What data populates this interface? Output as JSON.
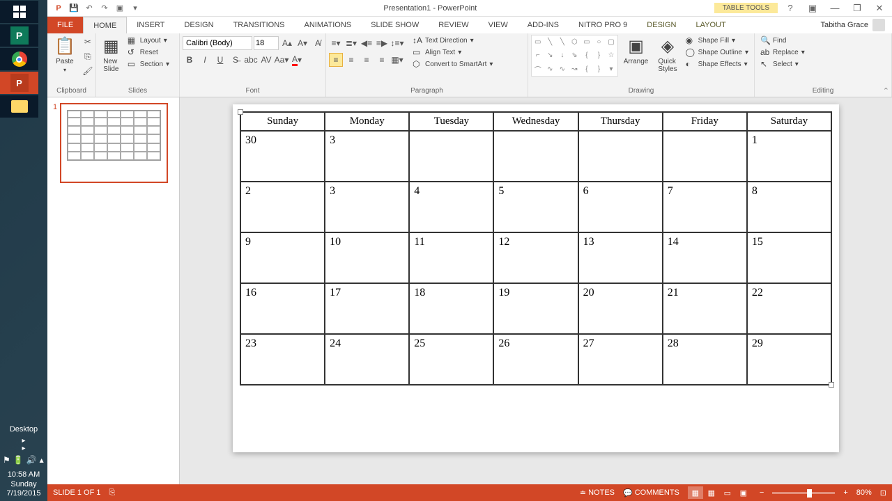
{
  "title": "Presentation1 - PowerPoint",
  "contextual_tab_group": "TABLE TOOLS",
  "user_name": "Tabitha Grace",
  "tabs": {
    "file": "FILE",
    "home": "HOME",
    "insert": "INSERT",
    "design": "DESIGN",
    "transitions": "TRANSITIONS",
    "animations": "ANIMATIONS",
    "slideshow": "SLIDE SHOW",
    "review": "REVIEW",
    "view": "VIEW",
    "addins": "ADD-INS",
    "nitro": "NITRO PRO 9",
    "ctx_design": "DESIGN",
    "ctx_layout": "LAYOUT"
  },
  "ribbon": {
    "clipboard": {
      "label": "Clipboard",
      "paste": "Paste"
    },
    "slides": {
      "label": "Slides",
      "new_slide": "New\nSlide",
      "layout": "Layout",
      "reset": "Reset",
      "section": "Section"
    },
    "font": {
      "label": "Font",
      "name": "Calibri (Body)",
      "size": "18"
    },
    "paragraph": {
      "label": "Paragraph",
      "text_direction": "Text Direction",
      "align_text": "Align Text",
      "convert_smartart": "Convert to SmartArt"
    },
    "drawing": {
      "label": "Drawing",
      "arrange": "Arrange",
      "quick_styles": "Quick\nStyles",
      "shape_fill": "Shape Fill",
      "shape_outline": "Shape Outline",
      "shape_effects": "Shape Effects"
    },
    "editing": {
      "label": "Editing",
      "find": "Find",
      "replace": "Replace",
      "select": "Select"
    }
  },
  "slide_thumb_num": "1",
  "calendar": {
    "headers": [
      "Sunday",
      "Monday",
      "Tuesday",
      "Wednesday",
      "Thursday",
      "Friday",
      "Saturday"
    ],
    "rows": [
      [
        "30",
        "3",
        "",
        "",
        "",
        "",
        "1"
      ],
      [
        "2",
        "3",
        "4",
        "5",
        "6",
        "7",
        "8"
      ],
      [
        "9",
        "10",
        "11",
        "12",
        "13",
        "14",
        "15"
      ],
      [
        "16",
        "17",
        "18",
        "19",
        "20",
        "21",
        "22"
      ],
      [
        "23",
        "24",
        "25",
        "26",
        "27",
        "28",
        "29"
      ]
    ]
  },
  "statusbar": {
    "slide_info": "SLIDE 1 OF 1",
    "notes": "NOTES",
    "comments": "COMMENTS",
    "zoom": "80%"
  },
  "taskbar": {
    "desktop_label": "Desktop",
    "time": "10:58 AM",
    "day": "Sunday",
    "date": "7/19/2015"
  }
}
